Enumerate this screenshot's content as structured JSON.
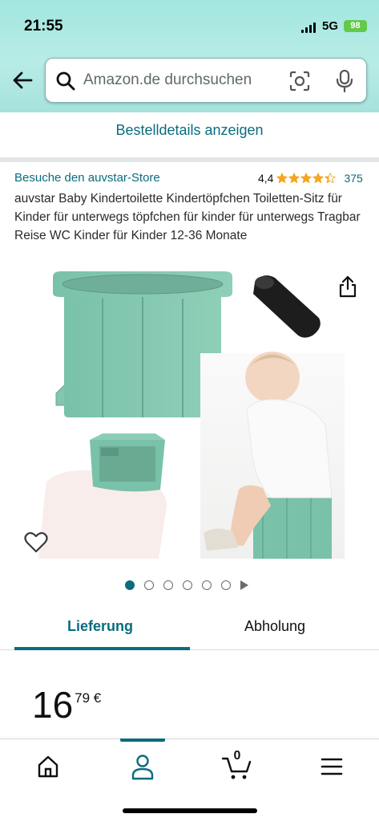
{
  "status_bar": {
    "time": "21:55",
    "network": "5G",
    "battery": "98"
  },
  "search": {
    "placeholder": "Amazon.de durchsuchen"
  },
  "order": {
    "link": "Bestelldetails anzeigen"
  },
  "product": {
    "store_link": "Besuche den auvstar-Store",
    "rating_value": "4,4",
    "rating_stars": 4.4,
    "rating_count": "375",
    "title": "auvstar Baby Kindertoilette Kindertöpfchen Toiletten-Sitz für Kinder für unterwegs töpfchen für kinder für unterwegs Tragbar Reise WC Kinder für Kinder 12-36 Monate",
    "image_count": 6,
    "active_image": 0
  },
  "tabs": [
    {
      "label": "Lieferung",
      "active": true
    },
    {
      "label": "Abholung",
      "active": false
    }
  ],
  "price": {
    "whole": "16",
    "fraction": "79 €"
  },
  "bottom_nav": {
    "items": [
      "home-icon",
      "account-icon",
      "cart-icon",
      "menu-icon"
    ],
    "cart_count": "0",
    "active": "account-icon"
  },
  "colors": {
    "header": "#a3e6e0",
    "link": "#0b6c7e",
    "star": "#f5a623",
    "product_green": "#7ec7ad"
  }
}
